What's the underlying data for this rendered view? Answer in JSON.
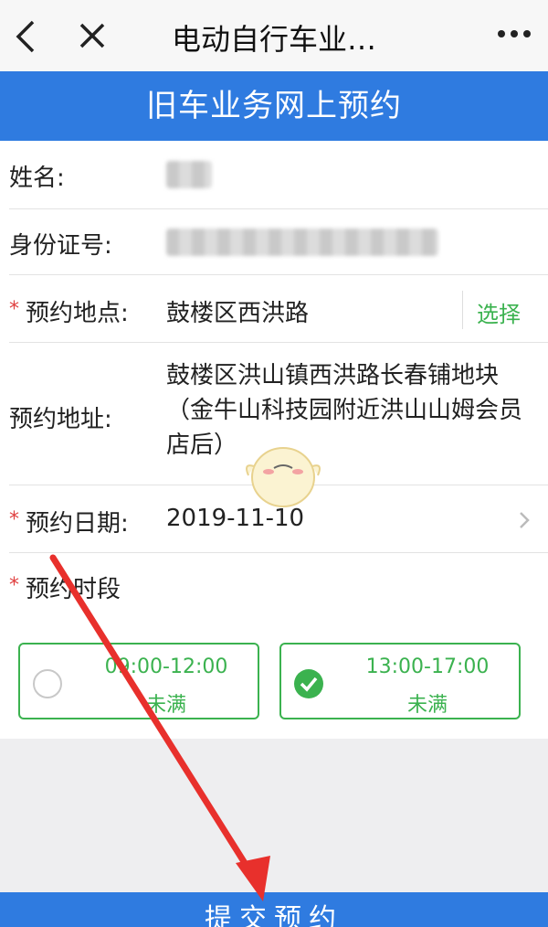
{
  "navbar": {
    "title": "电动自行车业…",
    "back_icon": "back-icon",
    "close_icon": "close-icon",
    "more_icon": "more-icon"
  },
  "banner": {
    "title": "旧车业务网上预约"
  },
  "form": {
    "name_label": "姓名:",
    "id_label": "身份证号:",
    "location": {
      "required": "*",
      "label": "预约地点:",
      "value": "鼓楼区西洪路",
      "action": "选择"
    },
    "address": {
      "label": "预约地址:",
      "value": "鼓楼区洪山镇西洪路长春铺地块（金牛山科技园附近洪山山姆会员店后）"
    },
    "date": {
      "required": "*",
      "label": "预约日期:",
      "value": "2019-11-10"
    },
    "period": {
      "required": "*",
      "label": "预约时段"
    },
    "slots": [
      {
        "time": "09:00-12:00",
        "status": "未满",
        "selected": false
      },
      {
        "time": "13:00-17:00",
        "status": "未满",
        "selected": true
      }
    ]
  },
  "submit": {
    "label": "提交预约"
  },
  "colors": {
    "accent_blue": "#2f7be0",
    "accent_green": "#3bb24f",
    "required_red": "#e04040"
  }
}
